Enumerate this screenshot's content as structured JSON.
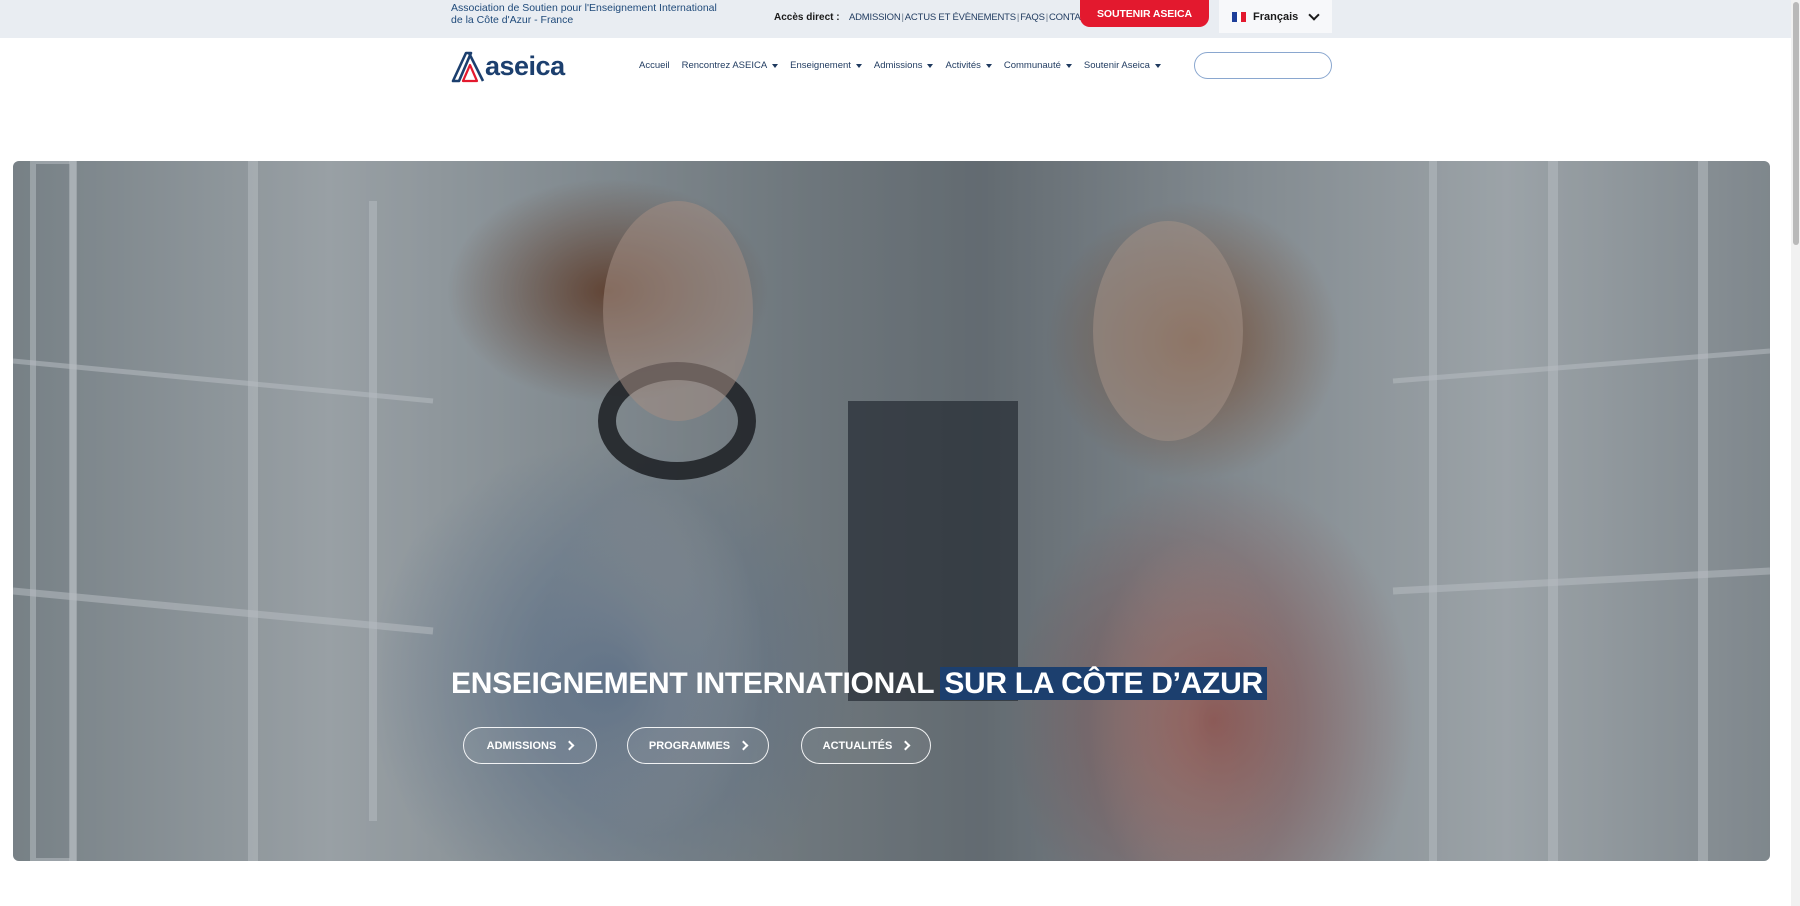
{
  "topbar": {
    "association_line1": "Association de Soutien pour l'Enseignement International",
    "association_line2": "de la Côte d'Azur - France",
    "acces_label": "Accès direct :",
    "quick_links": [
      "ADMISSION",
      "ACTUS ET ÉVÈNEMENTS",
      "FAQS",
      "CONTACT"
    ],
    "cta_label": "SOUTENIR ASEICA",
    "language": "Français"
  },
  "header": {
    "logo_text": "aseica",
    "nav": [
      "Accueil",
      "Rencontrez ASEICA",
      "Enseignement",
      "Admissions",
      "Activités",
      "Communauté",
      "Soutenir Aseica"
    ],
    "nav_has_dropdown": [
      false,
      true,
      true,
      true,
      true,
      true,
      true
    ],
    "search_placeholder": ""
  },
  "hero": {
    "title_main": "ENSEIGNEMENT INTERNATIONAL",
    "title_highlight": "SUR LA CÔTE D’AZUR",
    "buttons": [
      "ADMISSIONS",
      "PROGRAMMES",
      "ACTUALITÉS"
    ]
  },
  "colors": {
    "brand_navy": "#1c3f6e",
    "cta_red": "#e3192e",
    "topbar_bg": "#e9edf2"
  }
}
